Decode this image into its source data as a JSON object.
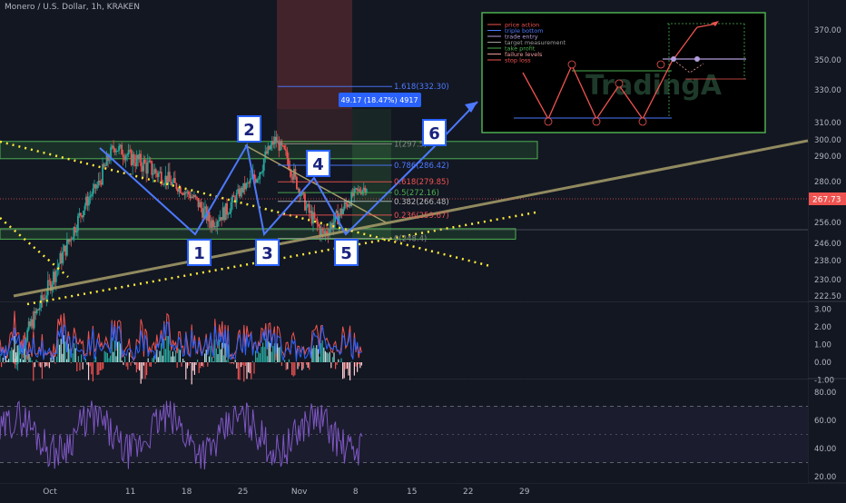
{
  "header": {
    "title": "Monero / U.S. Dollar, 1h, KRAKEN"
  },
  "chart_data": [
    {
      "type": "line",
      "title": "Monero / U.S. Dollar, 1h, KRAKEN",
      "y_axis_side": "right",
      "ylim": [
        220,
        385
      ],
      "yticks": [
        222.5,
        230.0,
        238.0,
        246.0,
        256.0,
        267.73,
        280.0,
        290.0,
        300.0,
        310.0,
        330.0,
        350.0,
        370.0
      ],
      "ytick_labels": [
        "222.50",
        "230.00",
        "238.00",
        "246.00",
        "256.00",
        "267.73",
        "280.00",
        "290.00",
        "300.00",
        "310.00",
        "330.00",
        "350.00",
        "370.00"
      ],
      "current_price": "267.73",
      "x_tick_labels": [
        "Oct",
        "11",
        "18",
        "25",
        "Nov",
        "8",
        "15",
        "22",
        "29"
      ],
      "x_tick_days": [
        0,
        10,
        17,
        24,
        31,
        38,
        45,
        52,
        59
      ],
      "series": [
        {
          "values_t": [
            0,
            2,
            4,
            6,
            8,
            10,
            12,
            14,
            16,
            18,
            20,
            22,
            24,
            26,
            28,
            30,
            32,
            34,
            36,
            38,
            40
          ],
          "values_price": [
            228,
            244,
            262,
            278,
            296,
            290,
            286,
            282,
            276,
            268,
            256,
            262,
            275,
            284,
            300,
            286,
            262,
            250,
            260,
            272,
            279
          ],
          "style": "candles"
        }
      ],
      "pattern_points": [
        {
          "label": "1",
          "price": 251
        },
        {
          "label": "2",
          "price": 300
        },
        {
          "label": "3",
          "price": 253
        },
        {
          "label": "4",
          "price": 276
        },
        {
          "label": "5",
          "price": 252
        },
        {
          "label": "6",
          "price": 312
        }
      ],
      "fib_levels": [
        {
          "label": "1.618(332.30)",
          "price": 332.3,
          "color": "#4d79ff"
        },
        {
          "label": "1(297.5)",
          "price": 297.5,
          "color": "#888888"
        },
        {
          "label": "0.786(286.42)",
          "price": 286.42,
          "color": "#4d79ff"
        },
        {
          "label": "0.618(279.85)",
          "price": 279.85,
          "color": "#ef5350"
        },
        {
          "label": "0.5(272.16)",
          "price": 272.16,
          "color": "#4caf50"
        },
        {
          "label": "0.382(266.48)",
          "price": 266.48,
          "color": "#bbbbbb"
        },
        {
          "label": "0.236(259.67)",
          "price": 259.67,
          "color": "#ef5350"
        },
        {
          "label": "0(248.4)",
          "price": 248.4,
          "color": "#888888"
        }
      ],
      "measure_label": "49.17 (18.47%) 4917",
      "zones": [
        {
          "name": "resistance",
          "price_top": 299,
          "price_bottom": 289
        },
        {
          "name": "support",
          "price_top": 253,
          "price_bottom": 248
        }
      ],
      "colors": {
        "up": "#26a69a",
        "down": "#ef5350",
        "zone": "#4caf50",
        "trend": "#a89f6a",
        "dotted": "#ffeb3b",
        "wave": "#4d79ff"
      }
    },
    {
      "type": "bar",
      "name": "oscillator",
      "ylim": [
        -1.5,
        3.5
      ],
      "yticks": [
        -1.0,
        0.0,
        1.0,
        2.0,
        3.0
      ],
      "ytick_labels": [
        "-1.00",
        "0.00",
        "1.00",
        "2.00",
        "3.00"
      ]
    },
    {
      "type": "line",
      "name": "rsi",
      "ylim": [
        15,
        85
      ],
      "yticks": [
        20,
        40,
        60,
        80
      ],
      "ytick_labels": [
        "20.00",
        "40.00",
        "60.00",
        "80.00"
      ],
      "color": "#7e57c2"
    }
  ],
  "legend_box": {
    "items": [
      {
        "label": "price action",
        "color": "#ef5350"
      },
      {
        "label": "triple bottom",
        "color": "#4d79ff"
      },
      {
        "label": "trade entry",
        "color": "#b39ddb"
      },
      {
        "label": "target measurement",
        "color": "#9e9e9e"
      },
      {
        "label": "take profit",
        "color": "#4caf50"
      },
      {
        "label": "failure levels",
        "color": "#ef9a9a"
      },
      {
        "label": "stop loss",
        "color": "#ef5350"
      }
    ],
    "watermark": "TradingA"
  }
}
